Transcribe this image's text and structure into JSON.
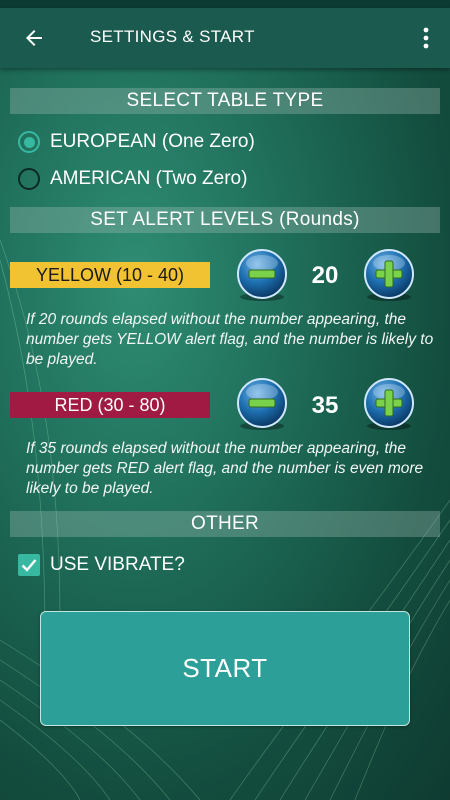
{
  "header": {
    "title": "SETTINGS & START",
    "back_icon": "arrow-left-icon",
    "menu_icon": "more-vert-icon"
  },
  "sections": {
    "table_type": "SELECT TABLE TYPE",
    "alert_levels": "SET ALERT LEVELS (Rounds)",
    "other": "OTHER"
  },
  "table_types": [
    {
      "label": "EUROPEAN (One Zero)",
      "selected": true
    },
    {
      "label": "AMERICAN (Two Zero)",
      "selected": false
    }
  ],
  "alerts": {
    "yellow": {
      "label": "YELLOW (10 - 40)",
      "value": "20",
      "description": "If 20 rounds elapsed without the number appearing, the number gets YELLOW alert flag, and the number is likely to be played.",
      "color": "#f1c232"
    },
    "red": {
      "label": "RED (30 - 80)",
      "value": "35",
      "description": "If 35 rounds elapsed without the number appearing, the number gets RED alert flag, and the number is even more likely to be played.",
      "color": "#a01a43"
    }
  },
  "other": {
    "vibrate_label": "USE VIBRATE?",
    "vibrate_checked": true
  },
  "start_label": "START",
  "colors": {
    "accent": "#37b8a1",
    "appbar": "#1b5a4e",
    "start_button": "#2c9f98"
  }
}
